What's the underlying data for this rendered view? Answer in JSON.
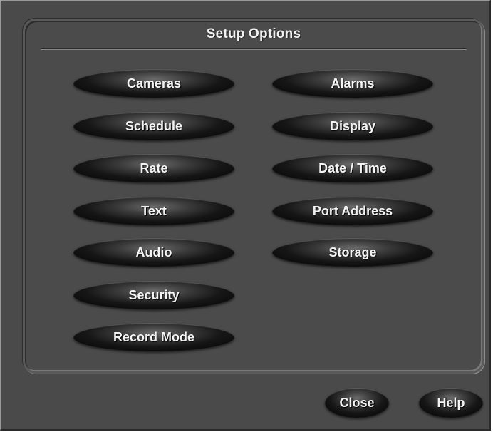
{
  "panel": {
    "title": "Setup Options"
  },
  "left_buttons": [
    {
      "label": "Cameras"
    },
    {
      "label": "Schedule"
    },
    {
      "label": "Rate"
    },
    {
      "label": "Text"
    },
    {
      "label": "Audio"
    },
    {
      "label": "Security"
    },
    {
      "label": "Record Mode"
    }
  ],
  "right_buttons": [
    {
      "label": "Alarms"
    },
    {
      "label": "Display"
    },
    {
      "label": "Date / Time"
    },
    {
      "label": "Port Address"
    },
    {
      "label": "Storage"
    }
  ],
  "footer": {
    "close_label": "Close",
    "help_label": "Help"
  },
  "colors": {
    "background": "#4a4a4a",
    "button": "#161616",
    "text": "#f4f4f4"
  }
}
